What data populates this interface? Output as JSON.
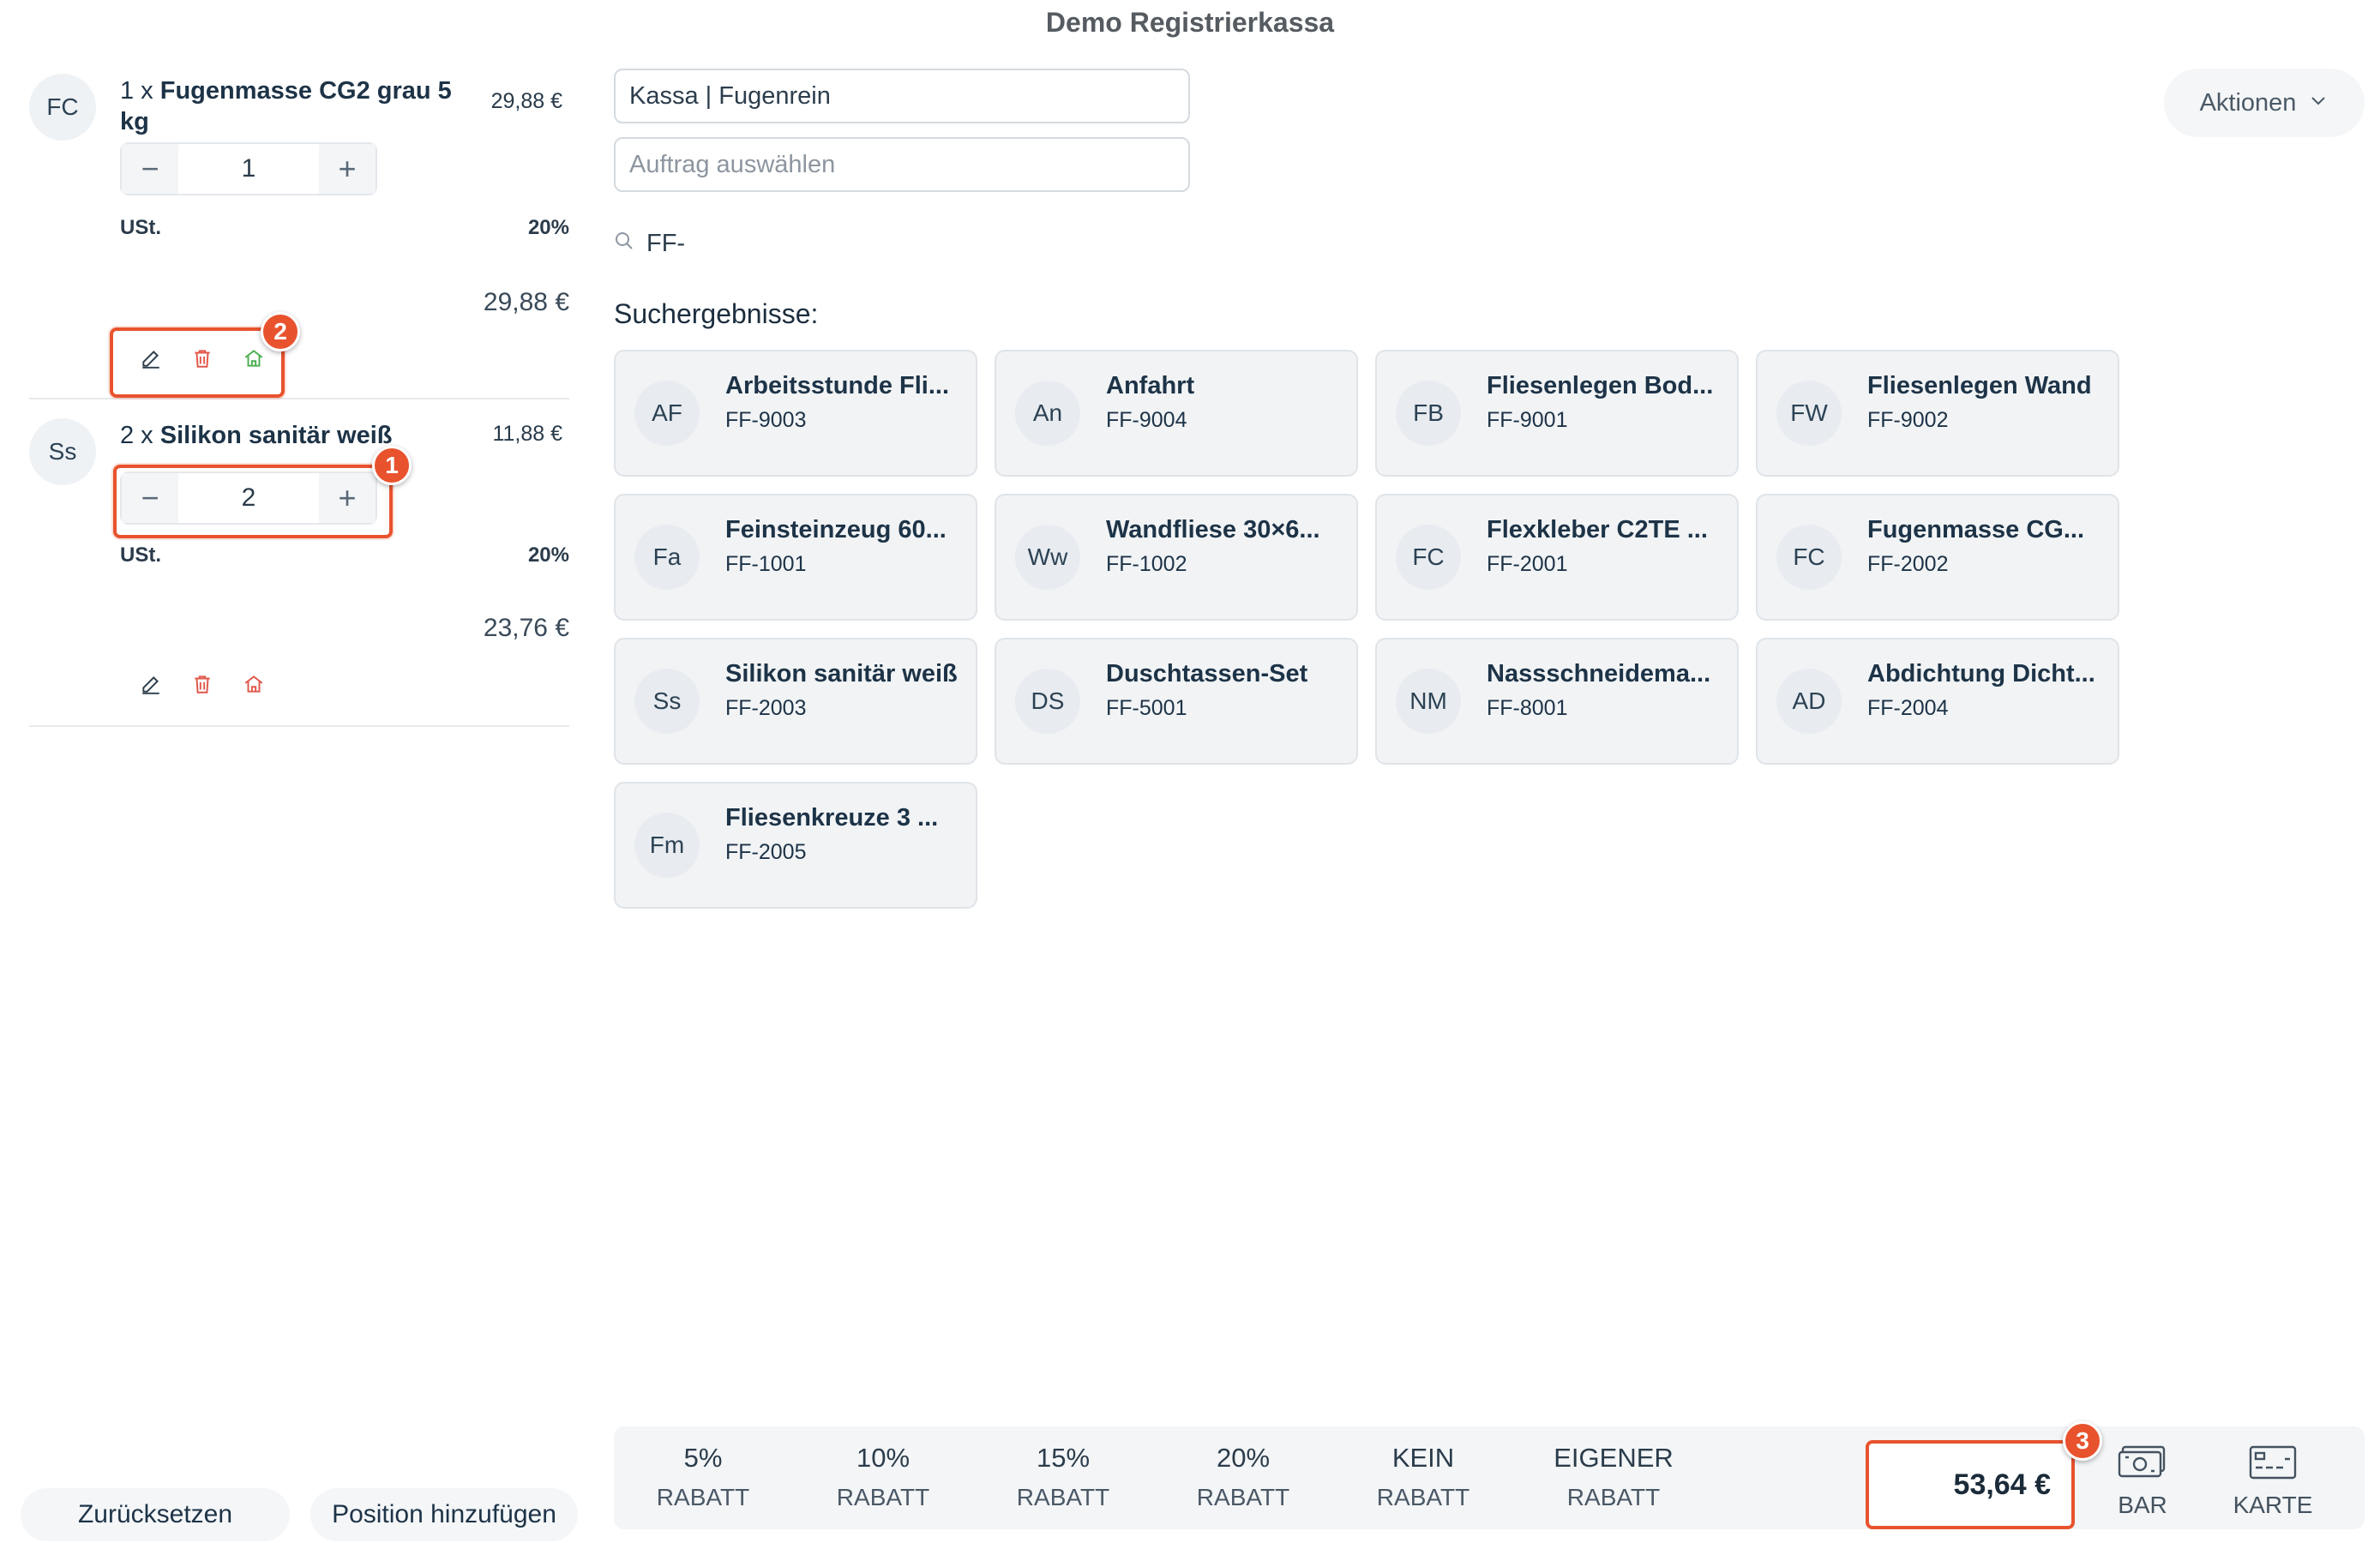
{
  "window": {
    "title": "Demo Registrierkassa"
  },
  "cart": {
    "items": [
      {
        "avatar": "FC",
        "qty_prefix": "1 x ",
        "name": "Fugenmasse CG2 grau 5 kg",
        "unit_price": "29,88 €",
        "quantity": "1",
        "tax_label": "USt.",
        "tax_rate": "20%",
        "total": "29,88 €"
      },
      {
        "avatar": "Ss",
        "qty_prefix": "2 x ",
        "name": "Silikon sanitär weiß",
        "unit_price": "11,88 €",
        "quantity": "2",
        "tax_label": "USt.",
        "tax_rate": "20%",
        "total": "23,76 €"
      }
    ],
    "icons": {
      "edit": "pencil-icon",
      "delete": "trash-icon",
      "storage": "house-icon"
    }
  },
  "header": {
    "register_field": "Kassa | Fugenrein",
    "order_placeholder": "Auftrag auswählen",
    "search_value": "FF-",
    "actions_label": "Aktionen"
  },
  "results": {
    "title": "Suchergebnisse:",
    "items": [
      {
        "avatar": "AF",
        "name": "Arbeitsstunde Fli...",
        "sku": "FF-9003"
      },
      {
        "avatar": "An",
        "name": "Anfahrt",
        "sku": "FF-9004"
      },
      {
        "avatar": "FB",
        "name": "Fliesenlegen Bod...",
        "sku": "FF-9001"
      },
      {
        "avatar": "FW",
        "name": "Fliesenlegen Wand",
        "sku": "FF-9002"
      },
      {
        "avatar": "Fa",
        "name": "Feinsteinzeug 60...",
        "sku": "FF-1001"
      },
      {
        "avatar": "Ww",
        "name": "Wandfliese 30×6...",
        "sku": "FF-1002"
      },
      {
        "avatar": "FC",
        "name": "Flexkleber C2TE ...",
        "sku": "FF-2001"
      },
      {
        "avatar": "FC",
        "name": "Fugenmasse CG...",
        "sku": "FF-2002"
      },
      {
        "avatar": "Ss",
        "name": "Silikon sanitär weiß",
        "sku": "FF-2003"
      },
      {
        "avatar": "DS",
        "name": "Duschtassen-Set",
        "sku": "FF-5001"
      },
      {
        "avatar": "NM",
        "name": "Nassschneidema...",
        "sku": "FF-8001"
      },
      {
        "avatar": "AD",
        "name": "Abdichtung Dicht...",
        "sku": "FF-2004"
      },
      {
        "avatar": "Fm",
        "name": "Fliesenkreuze 3 ...",
        "sku": "FF-2005"
      }
    ]
  },
  "discounts": [
    {
      "line1": "5%",
      "line2": "RABATT"
    },
    {
      "line1": "10%",
      "line2": "RABATT"
    },
    {
      "line1": "15%",
      "line2": "RABATT"
    },
    {
      "line1": "20%",
      "line2": "RABATT"
    },
    {
      "line1": "KEIN",
      "line2": "RABATT"
    },
    {
      "line1": "EIGENER",
      "line2": "RABATT"
    }
  ],
  "payment": {
    "total": "53,64 €",
    "cash_label": "BAR",
    "card_label": "KARTE"
  },
  "footer": {
    "reset_label": "Zurücksetzen",
    "add_position_label": "Position hinzufügen"
  },
  "annotations": {
    "badge1": "1",
    "badge2": "2",
    "badge3": "3"
  },
  "colors": {
    "highlight": "#e8532e",
    "text": "#1d3347",
    "card_bg": "#f1f3f5"
  }
}
